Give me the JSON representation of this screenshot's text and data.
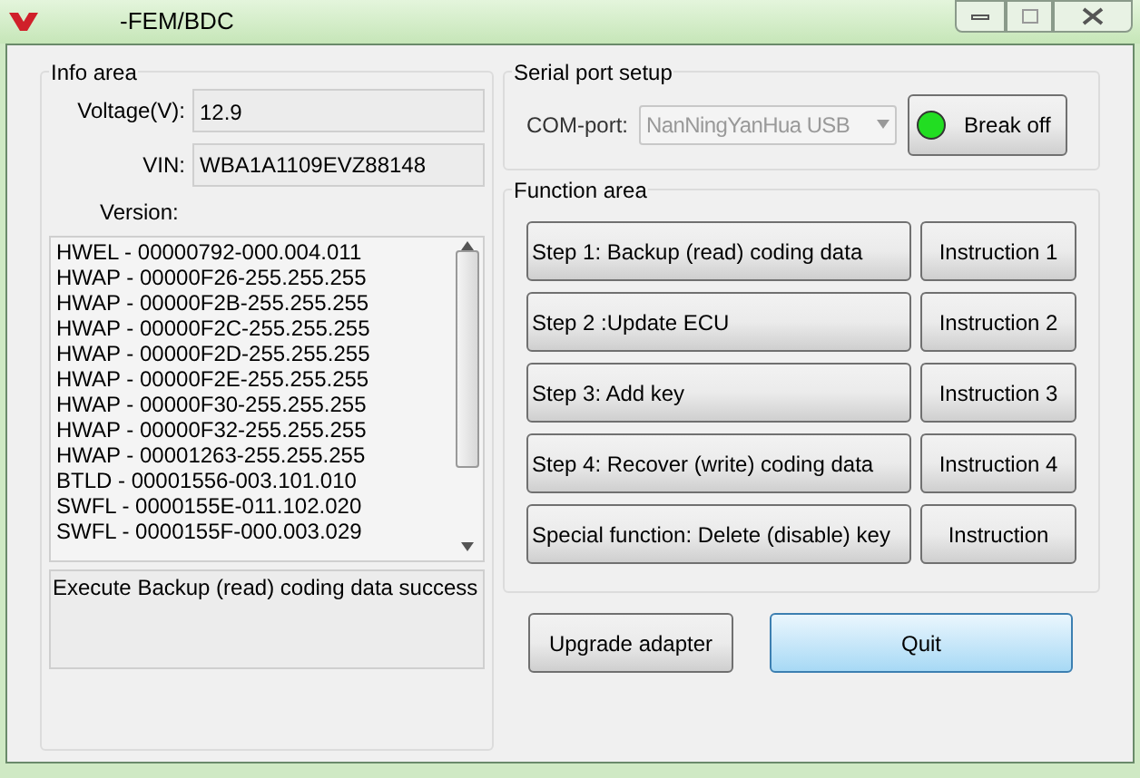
{
  "window": {
    "title": "-FEM/BDC"
  },
  "info_area": {
    "title": "Info area",
    "voltage": {
      "label": "Voltage(V):",
      "value": "12.9"
    },
    "vin": {
      "label": "VIN:",
      "value": "WBA1A1109EVZ88148"
    },
    "version_label": "Version:",
    "versions": [
      "HWEL - 00000792-000.004.011",
      "HWAP - 00000F26-255.255.255",
      "HWAP - 00000F2B-255.255.255",
      "HWAP - 00000F2C-255.255.255",
      "HWAP - 00000F2D-255.255.255",
      "HWAP - 00000F2E-255.255.255",
      "HWAP - 00000F30-255.255.255",
      "HWAP - 00000F32-255.255.255",
      "HWAP - 00001263-255.255.255",
      "BTLD - 00001556-003.101.010",
      "SWFL - 0000155E-011.102.020",
      "SWFL - 0000155F-000.003.029"
    ],
    "log": "Execute Backup (read) coding data success"
  },
  "serial_port": {
    "title": "Serial port setup",
    "label": "COM-port:",
    "value": "NanNingYanHua USB",
    "connected": true,
    "button": "Break off"
  },
  "function_area": {
    "title": "Function area",
    "rows": [
      {
        "action": "Step 1: Backup (read) coding data",
        "instruction": "Instruction 1"
      },
      {
        "action": "Step 2 :Update ECU",
        "instruction": "Instruction 2"
      },
      {
        "action": "Step 3: Add key",
        "instruction": "Instruction 3"
      },
      {
        "action": "Step 4: Recover (write) coding data",
        "instruction": "Instruction 4"
      },
      {
        "action": "Special function: Delete (disable) key",
        "instruction": "Instruction"
      }
    ]
  },
  "buttons": [
    {
      "label": "Upgrade adapter",
      "focused": false
    },
    {
      "label": "Quit",
      "focused": true
    }
  ]
}
